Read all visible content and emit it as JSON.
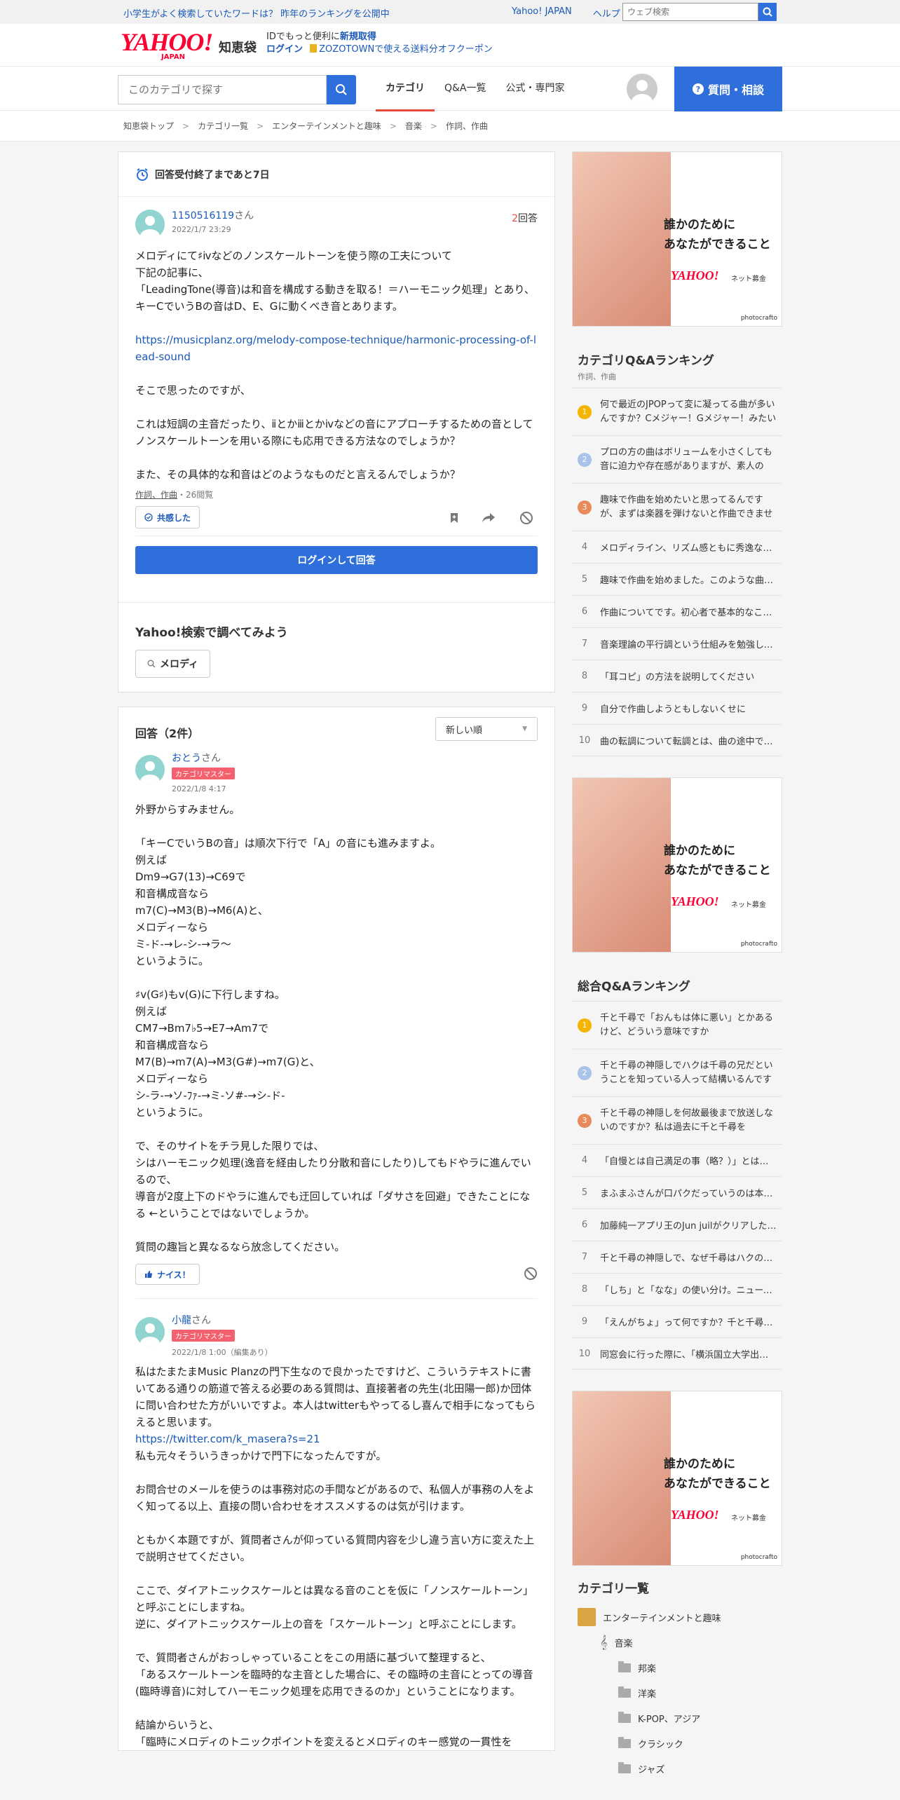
{
  "topbar": {
    "promo": "小学生がよく検索していたワードは？ 昨年のランキングを公開中",
    "links": [
      "Yahoo! JAPAN",
      "ヘルプ"
    ],
    "search_placeholder": "ウェブ検索"
  },
  "brand": {
    "logo": "YAHOO!",
    "logo_sub": "JAPAN",
    "service": "知恵袋",
    "id_line_prefix": "IDでもっと便利に",
    "id_line_link": "新規取得",
    "login": "ログイン",
    "zozo": "ZOZOTOWNで使える送料分オフクーポン"
  },
  "nav": {
    "category_search_placeholder": "このカテゴリで探す",
    "tabs": [
      "カテゴリ",
      "Q&A一覧",
      "公式・専門家"
    ],
    "ask_button": "質問・相談"
  },
  "breadcrumb": [
    "知恵袋トップ",
    "カテゴリ一覧",
    "エンターテインメントと趣味",
    "音楽",
    "作詞、作曲"
  ],
  "question": {
    "deadline": "回答受付終了まであと7日",
    "user": "1150516119",
    "user_suffix": "さん",
    "date": "2022/1/7 23:29",
    "answer_count": "2",
    "answer_count_label": "回答",
    "text_1": "メロディにて♯ⅳなどのノンスケールトーンを使う際の工夫について\n下記の記事に、\n「LeadingTone(導音)は和音を構成する動きを取る！＝ハーモニック処理」とあり、キーCでいうBの音はD、E、Gに動くべき音とあります。\n\n",
    "link": "https://musicplanz.org/melody-compose-technique/harmonic-processing-of-lead-sound",
    "text_2": "\n\nそこで思ったのですが、\n\nこれは短調の主音だったり、ⅱとかⅲとかⅳなどの音にアプローチするための音としてノンスケールトーンを用いる際にも応用できる方法なのでしょうか？\n\nまた、その具体的な和音はどのようなものだと言えるんでしょうか？",
    "category": "作詞、作曲",
    "views": "・26閲覧",
    "empathy": "共感した",
    "login_answer": "ログインして回答"
  },
  "ysearch": {
    "title": "Yahoo!検索で調べてみよう",
    "keyword": "メロディ"
  },
  "answers": {
    "title": "回答（2件）",
    "sort": "新しい順",
    "items": [
      {
        "user": "おとう",
        "suffix": "さん",
        "badge": "カテゴリマスター",
        "date": "2022/1/8 4:17",
        "text": "外野からすみません。\n\n「キーCでいうBの音」は順次下行で「A」の音にも進みますよ。\n例えば\nDm9→G7(13)→C69で\n和音構成音なら\nm7(C)→M3(B)→M6(A)と、\nメロディーなら\nミ-ド-→レ-シ-→ラ～\nというように。\n\n♯ⅴ(G♯)もⅴ(G)に下行しますね。\n例えば\nCM7→Bm7♭5→E7→Am7で\n和音構成音なら\nM7(B)→m7(A)→M3(G#)→m7(G)と、\nメロディーなら\nシ-ラ-→ソ-ﾌｧ-→ミ-ソ#-→シ-ド-\nというように。\n\nで、そのサイトをチラ見した限りでは、\nシはハーモニック処理(逸音を経由したり分散和音にしたり)してもドやラに進んでいるので、\n導音が2度上下のドやラに進んでも迂回していれば「ダサさを回避」できたことになる ←ということではないでしょうか。\n\n質問の趣旨と異なるなら放念してください。",
        "nice": "ナイス！"
      },
      {
        "user": "小龍",
        "suffix": "さん",
        "badge": "カテゴリマスター",
        "date": "2022/1/8 1:00（編集あり）",
        "text_1": "私はたまたまMusic Planzの門下生なので良かったですけど、こういうテキストに書いてある通りの筋道で答える必要のある質問は、直接著者の先生(北田陽一郎)か団体に問い合わせた方がいいですよ。本人はtwitterもやってるし喜んで相手になってもらえると思います。\n",
        "link": "https://twitter.com/k_masera?s=21",
        "text_2": "\n私も元々そういうきっかけで門下になったんですが。\n\nお問合せのメールを使うのは事務対応の手間などがあるので、私個人が事務の人をよく知ってる以上、直接の問い合わせをオススメするのは気が引けます。\n\nともかく本題ですが、質問者さんが仰っている質問内容を少し違う言い方に変えた上で説明させてください。\n\nここで、ダイアトニックスケールとは異なる音のことを仮に「ノンスケールトーン」と呼ぶことにしますね。\n逆に、ダイアトニックスケール上の音を「スケールトーン」と呼ぶことにします。\n\nで、質問者さんがおっしゃっていることをこの用語に基づいて整理すると、\n「あるスケールトーンを臨時的な主音とした場合に、その臨時の主音にとっての導音(臨時導音)に対してハーモニック処理を応用できるのか」ということになります。\n\n結論からいうと、\n「臨時にメロディのトニックポイントを変えるとメロディのキー感覚の一貫性を"
      }
    ]
  },
  "sidebar": {
    "ad": {
      "copy_1": "誰かのために",
      "copy_2": "あなたができること",
      "logo": "YAHOO!",
      "logo_sub": "JAPAN",
      "bokin": "ネット募金",
      "credit": "photocrafto"
    },
    "cat_rank": {
      "title": "カテゴリQ&Aランキング",
      "sub": "作詞、作曲",
      "items": [
        "何で最近のJPOPって変に凝ってる曲が多いんですか？Cメジャー！Gメジャー！みたいな",
        "プロの方の曲はボリュームを小さくしても音に迫力や存在感がありますが、素人の",
        "趣味で作曲を始めたいと思ってるんですが、まずは楽器を弾けないと作曲できませんか？",
        "メロディライン、リズム感ともに秀逸な曲を教えてください",
        "趣味で作曲を始めました。このような曲を作ったのですが",
        "作曲についてです。初心者で基本的なことが分かりません",
        "音楽理論の平行調という仕組みを勉強しています",
        "「耳コピ」の方法を説明してください",
        "自分で作曲しようともしないくせに",
        "曲の転調について転調とは、曲の途中でキーが変わることですか"
      ]
    },
    "all_rank": {
      "title": "総合Q&Aランキング",
      "items": [
        "千と千尋で「おんもは体に悪い」とかあるけど、どういう意味ですか",
        "千と千尋の神隠しでハクは千尋の兄だということを知っている人って結構いるんですか",
        "千と千尋の神隠しを何故最後まで放送しないのですか？私は過去に千と千尋を",
        "「自慢とは自己満足の事（略？）」とはどういう意味ですか",
        "まふまふさんが口パクだっていうのは本当ですか",
        "加藤純一アプリ王のJun juilがクリアした件について",
        "千と千尋の神隠しで、なぜ千尋はハクの名前を",
        "「しち」と「なな」の使い分け。ニュースなどで",
        "「えんがちょ」って何ですか？千と千尋の神隠しで",
        "同窓会に行った際に、「横浜国立大学出身です」と言ったら"
      ]
    },
    "catlist": {
      "title": "カテゴリ一覧",
      "root": "エンターテインメントと趣味",
      "music": "音楽",
      "subs": [
        "邦楽",
        "洋楽",
        "K-POP、アジア",
        "クラシック",
        "ジャズ"
      ]
    }
  },
  "colors": {
    "accent": "#2e6fdc",
    "brand": "#ff0033",
    "rank1": "#f4b400",
    "rank2": "#a9c4e8",
    "rank3": "#e98a5a",
    "badge": "#f4616e"
  }
}
